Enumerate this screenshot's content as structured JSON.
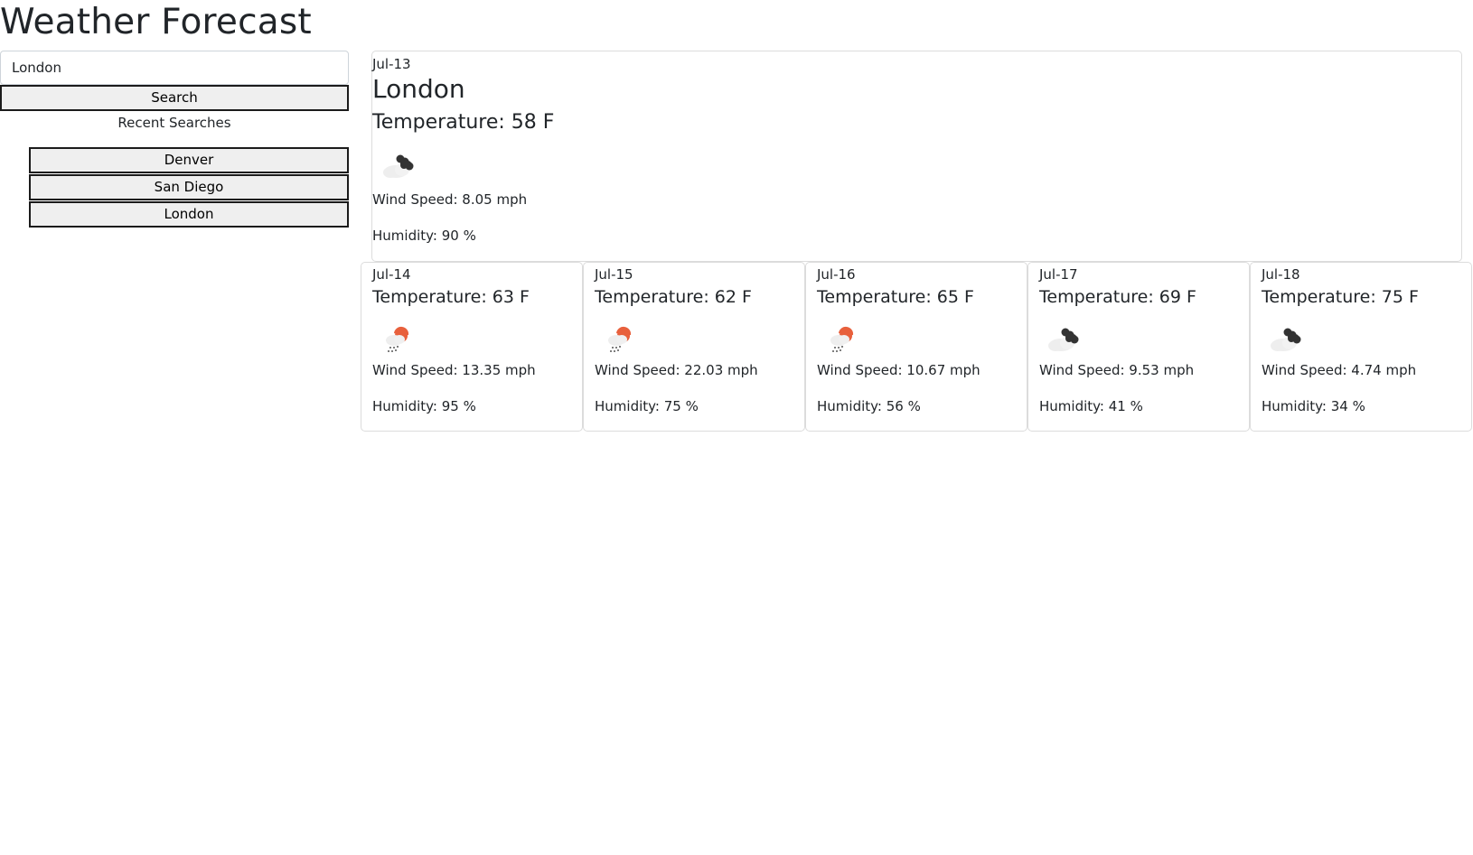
{
  "page": {
    "title": "Weather Forecast"
  },
  "search": {
    "value": "London",
    "button_label": "Search"
  },
  "recent": {
    "title": "Recent Searches",
    "items": [
      "Denver",
      "San Diego",
      "London"
    ]
  },
  "current": {
    "date": "Jul-13",
    "city": "London",
    "temperature": "Temperature: 58 F",
    "icon": "broken-clouds-icon",
    "wind": "Wind Speed: 8.05 mph",
    "humidity": "Humidity: 90 %"
  },
  "forecast": [
    {
      "date": "Jul-14",
      "temperature": "Temperature: 63 F",
      "icon": "light-rain-icon",
      "wind": "Wind Speed: 13.35 mph",
      "humidity": "Humidity: 95 %"
    },
    {
      "date": "Jul-15",
      "temperature": "Temperature: 62 F",
      "icon": "light-rain-icon",
      "wind": "Wind Speed: 22.03 mph",
      "humidity": "Humidity: 75 %"
    },
    {
      "date": "Jul-16",
      "temperature": "Temperature: 65 F",
      "icon": "light-rain-icon",
      "wind": "Wind Speed: 10.67 mph",
      "humidity": "Humidity: 56 %"
    },
    {
      "date": "Jul-17",
      "temperature": "Temperature: 69 F",
      "icon": "broken-clouds-icon",
      "wind": "Wind Speed: 9.53 mph",
      "humidity": "Humidity: 41 %"
    },
    {
      "date": "Jul-18",
      "temperature": "Temperature: 75 F",
      "icon": "broken-clouds-icon",
      "wind": "Wind Speed: 4.74 mph",
      "humidity": "Humidity: 34 %"
    }
  ],
  "colors": {
    "text": "#212529",
    "card_border": "#dcdcdc",
    "button_bg": "#efefef",
    "sun_accent": "#e8603c",
    "dark_cloud": "#333333",
    "light_cloud": "#eeeeee"
  }
}
